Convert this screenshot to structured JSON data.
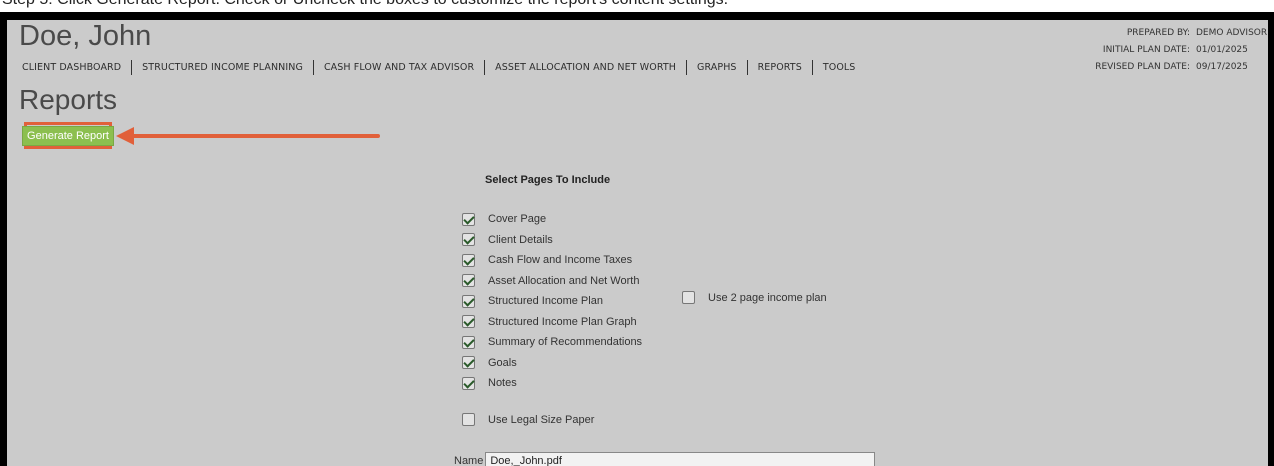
{
  "instruction": "Step 5: Click Generate Report. Check or Uncheck the boxes to customize the report's content settings.",
  "client": {
    "name": "Doe, John"
  },
  "nav": [
    {
      "label": "CLIENT DASHBOARD"
    },
    {
      "label": "STRUCTURED INCOME PLANNING"
    },
    {
      "label": "CASH FLOW AND TAX ADVISOR"
    },
    {
      "label": "ASSET ALLOCATION AND NET WORTH"
    },
    {
      "label": "GRAPHS"
    },
    {
      "label": "REPORTS"
    },
    {
      "label": "TOOLS"
    }
  ],
  "meta": {
    "prepared_by_label": "PREPARED BY:",
    "prepared_by": "DEMO ADVISOR",
    "initial_date_label": "INITIAL PLAN DATE:",
    "initial_date": "01/01/2025",
    "revised_date_label": "REVISED PLAN DATE:",
    "revised_date": "09/17/2025"
  },
  "section": {
    "title": "Reports",
    "generate_label": "Generate Report"
  },
  "pages": {
    "title": "Select Pages To Include",
    "items": [
      {
        "label": "Cover Page",
        "checked": true
      },
      {
        "label": "Client Details",
        "checked": true
      },
      {
        "label": "Cash Flow and Income Taxes",
        "checked": true
      },
      {
        "label": "Asset Allocation and Net Worth",
        "checked": true
      },
      {
        "label": "Structured Income Plan",
        "checked": true
      },
      {
        "label": "Structured Income Plan Graph",
        "checked": true
      },
      {
        "label": "Summary of Recommendations",
        "checked": true
      },
      {
        "label": "Goals",
        "checked": true
      },
      {
        "label": "Notes",
        "checked": true
      }
    ],
    "two_page_income": {
      "label": "Use 2 page income plan",
      "checked": false
    },
    "legal_paper": {
      "label": "Use Legal Size Paper",
      "checked": false
    }
  },
  "file": {
    "name_label": "Name",
    "name_value": "Doe,_John.pdf"
  },
  "colors": {
    "highlight": "#e1603a",
    "button": "#8cbf4f",
    "background": "#cbcbcb"
  }
}
